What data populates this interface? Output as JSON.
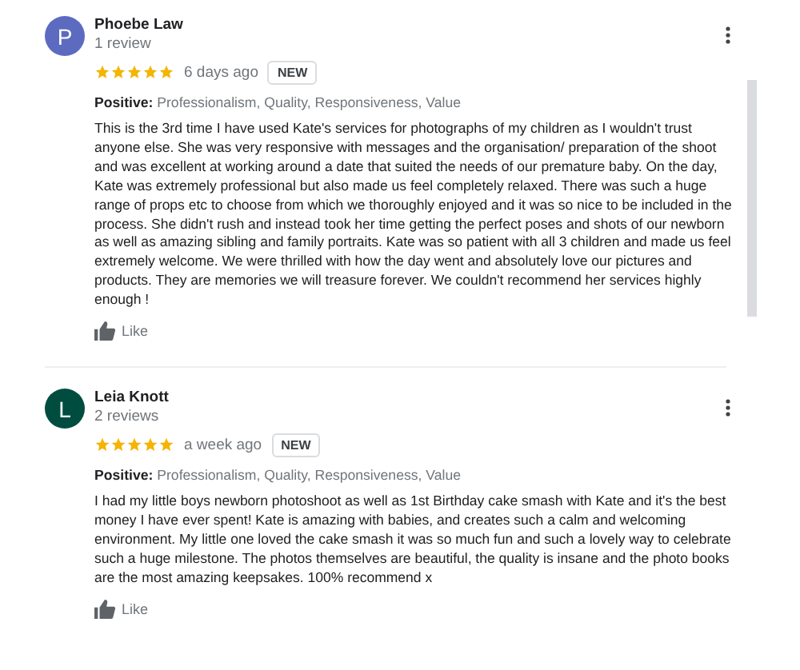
{
  "reviews": [
    {
      "initial": "P",
      "color": "#5c6bc0",
      "name": "Phoebe Law",
      "review_count": "1 review",
      "stars": 5,
      "time": "6 days ago",
      "badge": "NEW",
      "positive_label": "Positive:",
      "positive": "Professionalism, Quality, Responsiveness, Value",
      "text": "This is the 3rd time I have used Kate's services for photographs of my children as I wouldn't trust anyone else. She was very responsive with messages and the organisation/ preparation of the shoot and was excellent at working around a date that suited the needs of our premature baby. On the day, Kate was extremely professional but also made us feel completely relaxed. There was such a huge range of props etc to choose from which we thoroughly enjoyed and it was so nice to be included in the process. She didn't rush and instead took her time getting the perfect poses and shots of our newborn as well as amazing sibling and family portraits. Kate was so patient with all 3 children and made us feel extremely welcome. We were thrilled with how the day went and absolutely love our pictures and products. They are memories we will treasure forever. We couldn't recommend her services highly enough !",
      "like": "Like"
    },
    {
      "initial": "L",
      "color": "#004d40",
      "name": "Leia Knott",
      "review_count": "2 reviews",
      "stars": 5,
      "time": "a week ago",
      "badge": "NEW",
      "positive_label": "Positive:",
      "positive": "Professionalism, Quality, Responsiveness, Value",
      "text": "I had my little boys newborn photoshoot as well as 1st Birthday cake smash with Kate and it's the best money I have ever spent! Kate is amazing with babies, and creates such a calm and welcoming environment. My little one loved the cake smash it was so much fun and such a lovely way to celebrate such a huge milestone. The photos themselves are beautiful, the quality is insane and the photo books are the most amazing keepsakes. 100% recommend x",
      "like": "Like"
    }
  ]
}
